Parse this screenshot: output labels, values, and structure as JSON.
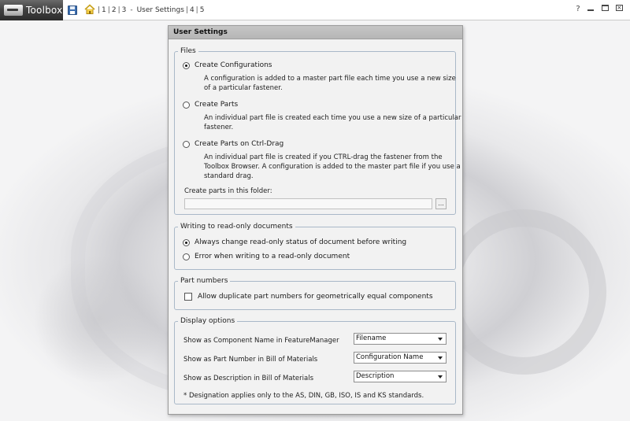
{
  "app": {
    "logo_text": "Toolbox"
  },
  "toolbar": {
    "breadcrumbs": [
      "1",
      "2",
      "3"
    ],
    "current_page": "User Settings",
    "after_pages": [
      "4",
      "5"
    ],
    "icons": [
      "save-icon",
      "home-icon",
      "help-icon",
      "minimize-icon",
      "restore-icon",
      "close-icon"
    ]
  },
  "dialog": {
    "title": "User Settings",
    "files": {
      "label": "Files",
      "options": [
        {
          "label": "Create Configurations",
          "selected": true,
          "description": "A configuration is added to a master part file each time you use a new size of a particular fastener."
        },
        {
          "label": "Create Parts",
          "selected": false,
          "description": "An individual part file is created each time you use a new size of a particular fastener."
        },
        {
          "label": "Create Parts on Ctrl-Drag",
          "selected": false,
          "description": "An individual part file is created if you CTRL-drag the fastener from the Toolbox Browser. A configuration is added to the master part file if you use a standard drag."
        }
      ],
      "folder_label": "Create parts in this folder:",
      "folder_value": "",
      "browse_label": "..."
    },
    "readonly": {
      "label": "Writing to read-only documents",
      "options": [
        {
          "label": "Always change read-only status of document before writing",
          "selected": true
        },
        {
          "label": "Error when writing to a read-only document",
          "selected": false
        }
      ]
    },
    "part_numbers": {
      "label": "Part numbers",
      "checkbox_label": "Allow duplicate part numbers for geometrically equal components",
      "checked": false
    },
    "display": {
      "label": "Display options",
      "rows": [
        {
          "label": "Show as Component Name in FeatureManager",
          "value": "Filename"
        },
        {
          "label": "Show as Part Number in Bill of Materials",
          "value": "Configuration Name"
        },
        {
          "label": "Show as Description in Bill of Materials",
          "value": "Description"
        }
      ],
      "note": "* Designation applies only to the AS, DIN, GB, ISO, IS and KS standards."
    }
  }
}
